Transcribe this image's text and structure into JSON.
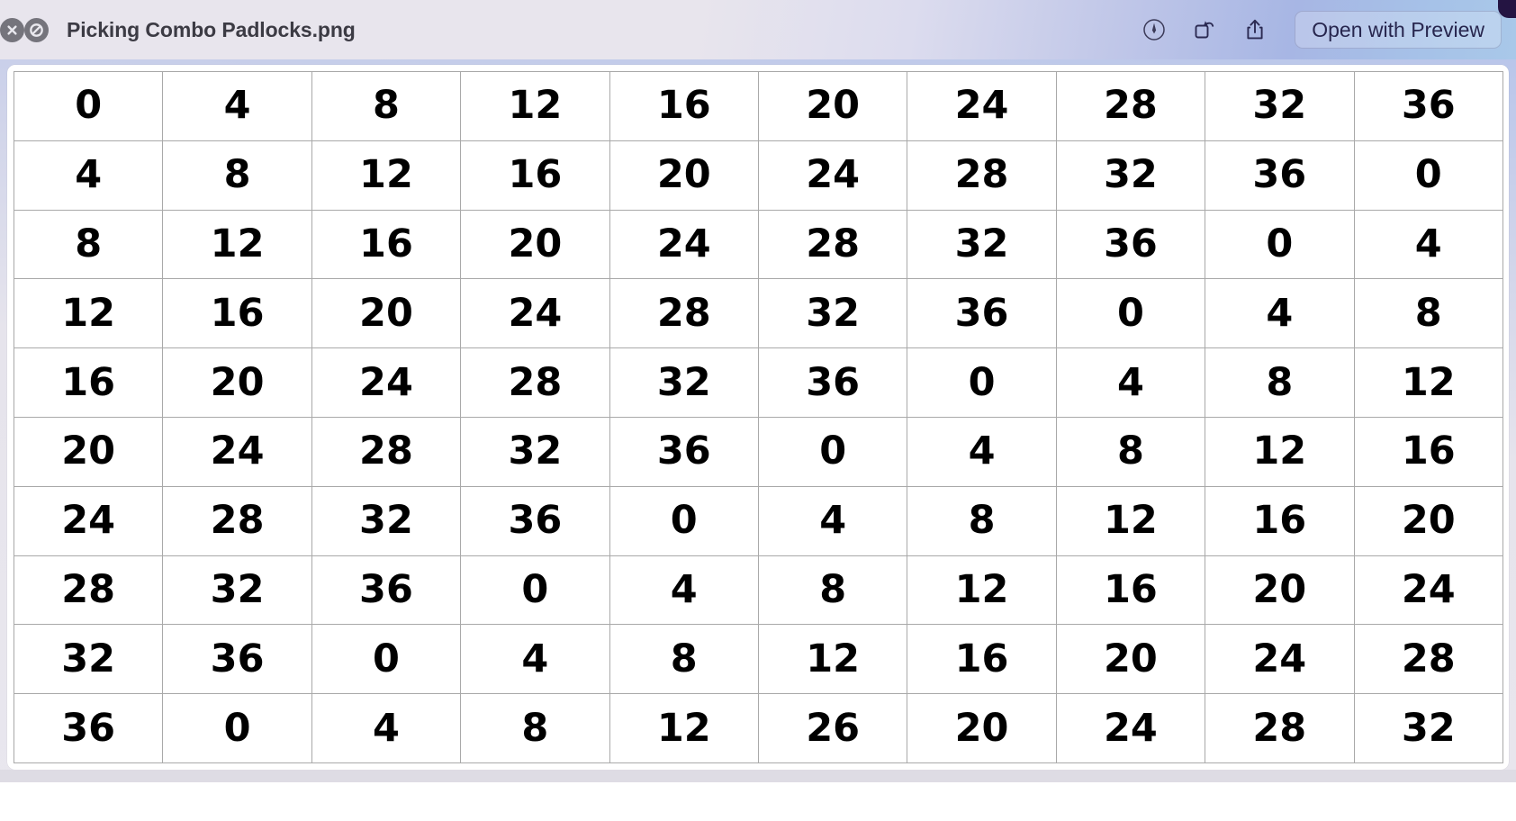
{
  "window": {
    "title": "Picking Combo Padlocks.png",
    "close_icon": "close-icon",
    "block_icon": "block-icon"
  },
  "toolbar": {
    "markup_icon": "markup-pen-icon",
    "rotate_icon": "rotate-icon",
    "share_icon": "share-icon",
    "open_with_preview_label": "Open with Preview"
  },
  "colors": {
    "titlebar_start": "#e8e5ed",
    "titlebar_end": "#a9c8e9",
    "corner_accent": "#241442",
    "window_button": "#75747c",
    "title_text": "#3c3b44",
    "action_text": "#27264e",
    "grid_line": "#a9a9a9",
    "cell_text": "#000000",
    "canvas_background": "#ffffff"
  },
  "chart_data": {
    "type": "table",
    "title": "Picking Combo Padlocks.png",
    "rows": 10,
    "columns": 10,
    "values": [
      [
        "0",
        "4",
        "8",
        "12",
        "16",
        "20",
        "24",
        "28",
        "32",
        "36"
      ],
      [
        "4",
        "8",
        "12",
        "16",
        "20",
        "24",
        "28",
        "32",
        "36",
        "0"
      ],
      [
        "8",
        "12",
        "16",
        "20",
        "24",
        "28",
        "32",
        "36",
        "0",
        "4"
      ],
      [
        "12",
        "16",
        "20",
        "24",
        "28",
        "32",
        "36",
        "0",
        "4",
        "8"
      ],
      [
        "16",
        "20",
        "24",
        "28",
        "32",
        "36",
        "0",
        "4",
        "8",
        "12"
      ],
      [
        "20",
        "24",
        "28",
        "32",
        "36",
        "0",
        "4",
        "8",
        "12",
        "16"
      ],
      [
        "24",
        "28",
        "32",
        "36",
        "0",
        "4",
        "8",
        "12",
        "16",
        "20"
      ],
      [
        "28",
        "32",
        "36",
        "0",
        "4",
        "8",
        "12",
        "16",
        "20",
        "24"
      ],
      [
        "32",
        "36",
        "0",
        "4",
        "8",
        "12",
        "16",
        "20",
        "24",
        "28"
      ],
      [
        "36",
        "0",
        "4",
        "8",
        "12",
        "26",
        "20",
        "24",
        "28",
        "32"
      ]
    ]
  }
}
